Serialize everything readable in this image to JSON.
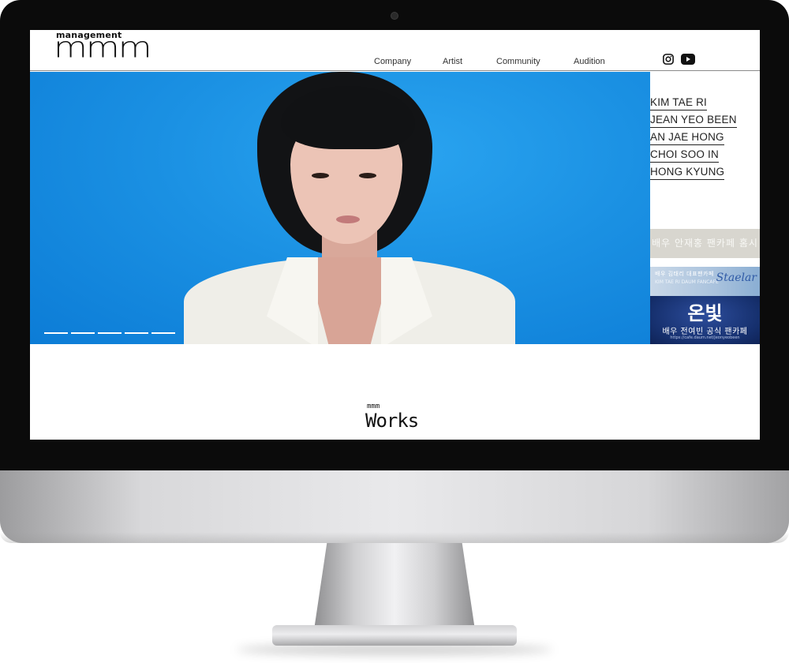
{
  "site": {
    "logo_small": "management",
    "logo_big": "mmm"
  },
  "nav": {
    "items": [
      "Company",
      "Artist",
      "Community",
      "Audition"
    ]
  },
  "social": {
    "instagram_icon": "instagram-icon",
    "youtube_icon": "youtube-icon"
  },
  "hero": {
    "background_color": "#1b91e3",
    "slide_count": 5
  },
  "artists": [
    "KIM TAE RI",
    "JEAN YEO BEEN",
    "AN JAE HONG",
    "CHOI SOO IN",
    "HONG KYUNG"
  ],
  "banners": {
    "b1": "배우 안재홍 팬카페 홈시",
    "b2_line1": "배우 김태리 대표팬카페",
    "b2_line2": "KIM TAE RI DAUM FANCAFE",
    "b2_brand": "Staelar",
    "b3_title": "온빛",
    "b3_sub": "배우 전여빈 공식 팬카페",
    "b3_url": "https://cafe.daum.net/jeonyeobeen"
  },
  "works": {
    "small": "mmm",
    "title": "Works"
  }
}
